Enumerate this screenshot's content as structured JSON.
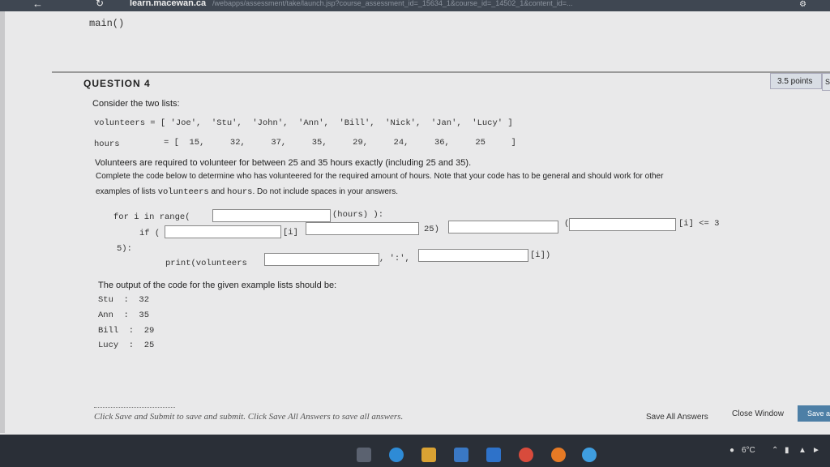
{
  "browser": {
    "url": "learn.macewan.ca",
    "url_rest": "/webapps/assessment/take/launch.jsp?course_assessment_id=_15634_1&course_id=_14502_1&content_id=..."
  },
  "previous_code": "main()",
  "question": {
    "title": "QUESTION 4",
    "points": "3.5 points",
    "points_next": "S",
    "intro": "Consider the two lists:",
    "volunteers_line": "volunteers = [ 'Joe',  'Stu',  'John',  'Ann',  'Bill',  'Nick',  'Jan',  'Lucy' ]",
    "hours_label": "hours",
    "hours_values": "= [  15,     32,     37,     35,     29,     24,     36,     25     ]",
    "requirement": "Volunteers are required to volunteer for between 25 and 35 hours exactly (including 25 and 35).",
    "instruction_1": "Complete the code below to determine who has volunteered for the required amount of hours. Note that your code has to be general and should work for other",
    "instruction_2_a": "examples of lists ",
    "instruction_2_code1": "volunteers",
    "instruction_2_b": " and ",
    "instruction_2_code2": "hours",
    "instruction_2_c": ". Do not include spaces in your answers.",
    "code": {
      "for_prefix": "for i in range(",
      "for_suffix": "(hours) ):",
      "if_prefix": "if (",
      "if_mid1": "[i]",
      "if_mid2": "25)",
      "if_paren": "(",
      "if_suffix": "[i] <= 3",
      "cont": "5):",
      "print_prefix": "print(volunteers",
      "print_mid": ", ':',",
      "print_suffix": "[i])"
    },
    "output_intro": "The output of the code for the given example lists should be:",
    "output_lines": [
      "Stu  :  32",
      "Ann  :  35",
      "Bill  :  29",
      "Lucy  :  25"
    ]
  },
  "footer": {
    "hint": "Click Save and Submit to save and submit. Click Save All Answers to save all answers.",
    "save_all": "Save All Answers",
    "close": "Close Window",
    "save_submit": "Save a"
  },
  "tray": {
    "weather": "6°C"
  }
}
